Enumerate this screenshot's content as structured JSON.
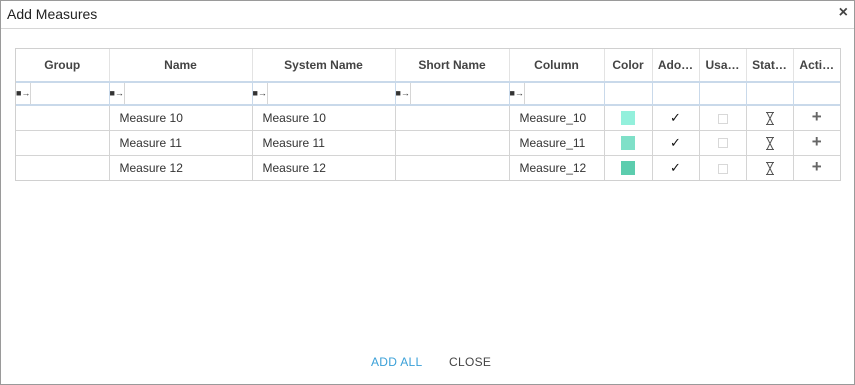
{
  "dialog": {
    "title": "Add Measures",
    "close_glyph": "×",
    "close_icon": "close-icon"
  },
  "grid": {
    "columns": [
      "Group",
      "Name",
      "System Name",
      "Short Name",
      "Column",
      "Color",
      "Ado…",
      "Usa…",
      "Stat…",
      "Acti…"
    ],
    "filter_operator_glyph": "■→",
    "rows": [
      {
        "group": "",
        "name": "Measure 10",
        "system_name": "Measure 10",
        "short_name": "",
        "column": "Measure_10",
        "color": "#93f0dc",
        "added": "✓",
        "plus": "+"
      },
      {
        "group": "",
        "name": "Measure 11",
        "system_name": "Measure 11",
        "short_name": "",
        "column": "Measure_11",
        "color": "#7fe0c8",
        "added": "✓",
        "plus": "+"
      },
      {
        "group": "",
        "name": "Measure 12",
        "system_name": "Measure 12",
        "short_name": "",
        "column": "Measure_12",
        "color": "#5ccdae",
        "added": "✓",
        "plus": "+"
      }
    ]
  },
  "footer": {
    "add_all_label": "ADD ALL",
    "close_label": "CLOSE",
    "accent_color": "#3aa0d8"
  }
}
